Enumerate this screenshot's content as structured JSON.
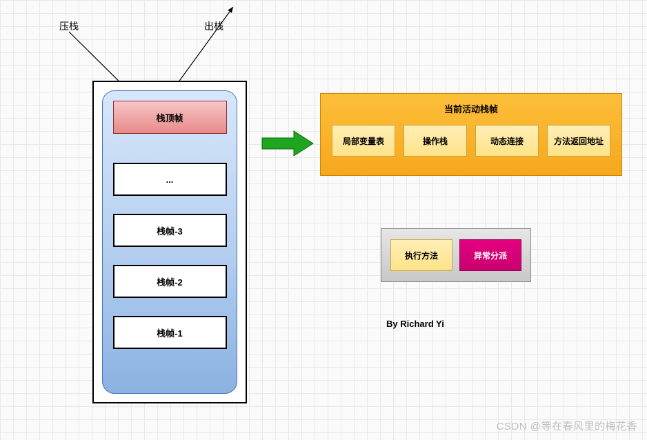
{
  "labels": {
    "push": "压栈",
    "pop": "出栈"
  },
  "stack": {
    "topFrame": "栈顶帧",
    "ellipsis": "...",
    "frame3": "栈帧-3",
    "frame2": "栈帧-2",
    "frame1": "栈帧-1"
  },
  "activeFrame": {
    "title": "当前活动栈帧",
    "cells": {
      "localVars": "局部变量表",
      "operandStack": "操作栈",
      "dynamicLink": "动态连接",
      "returnAddr": "方法返回地址"
    }
  },
  "handler": {
    "execMethod": "执行方法",
    "exceptionDispatch": "异常分派"
  },
  "author": "By Richard Yi",
  "watermark": "CSDN @等在春风里的梅花香"
}
